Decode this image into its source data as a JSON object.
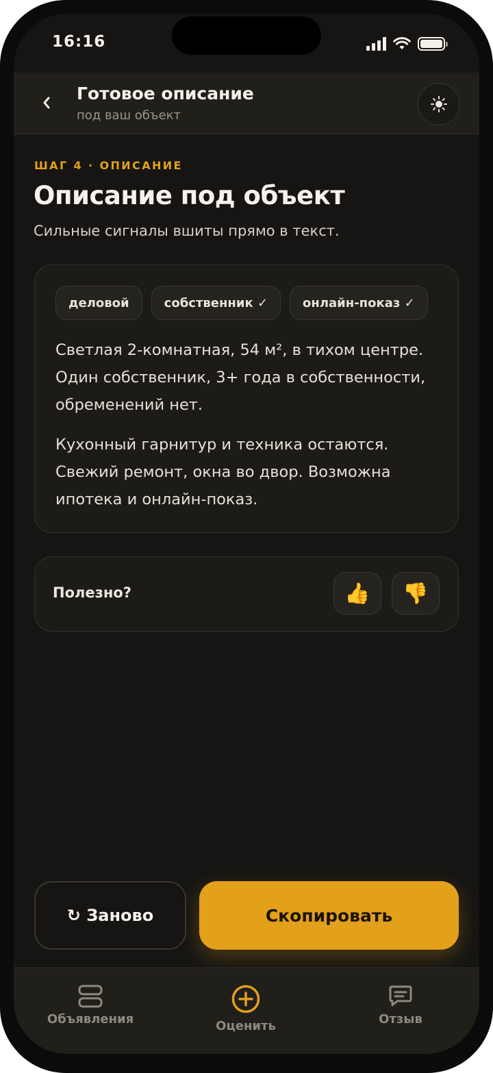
{
  "status_bar": {
    "time": "16:16"
  },
  "header": {
    "title": "Готовое описание",
    "subtitle": "под ваш объект",
    "back_icon": "chevron-left-icon",
    "theme_icon": "sun-icon"
  },
  "step": {
    "label": "ШАГ 4 · ОПИСАНИЕ"
  },
  "page": {
    "title": "Описание под объект",
    "subtitle": "Сильные сигналы вшиты прямо в текст."
  },
  "description": {
    "chips": [
      "деловой",
      "собственник ✓",
      "онлайн-показ ✓"
    ],
    "paragraphs": [
      "Светлая 2-комнатная, 54 м², в тихом центре. Один собственник, 3+ года в собственности, обременений нет.",
      "Кухонный гарнитур и техника остаются. Свежий ремонт, окна во двор. Возможна ипотека и онлайн-показ."
    ]
  },
  "feedback": {
    "label": "Полезно?",
    "thumbs_up": "👍",
    "thumbs_down": "👎"
  },
  "actions": {
    "again_label": "↻ Заново",
    "copy_label": "Скопировать"
  },
  "tabs": [
    {
      "label": "Объявления",
      "icon": "stack-icon"
    },
    {
      "label": "Оценить",
      "icon": "plus-circle-icon"
    },
    {
      "label": "Отзыв",
      "icon": "message-icon"
    }
  ],
  "colors": {
    "accent": "#e3a01b",
    "background": "#161513",
    "surface": "#1c1b18",
    "header": "#211f1a"
  }
}
